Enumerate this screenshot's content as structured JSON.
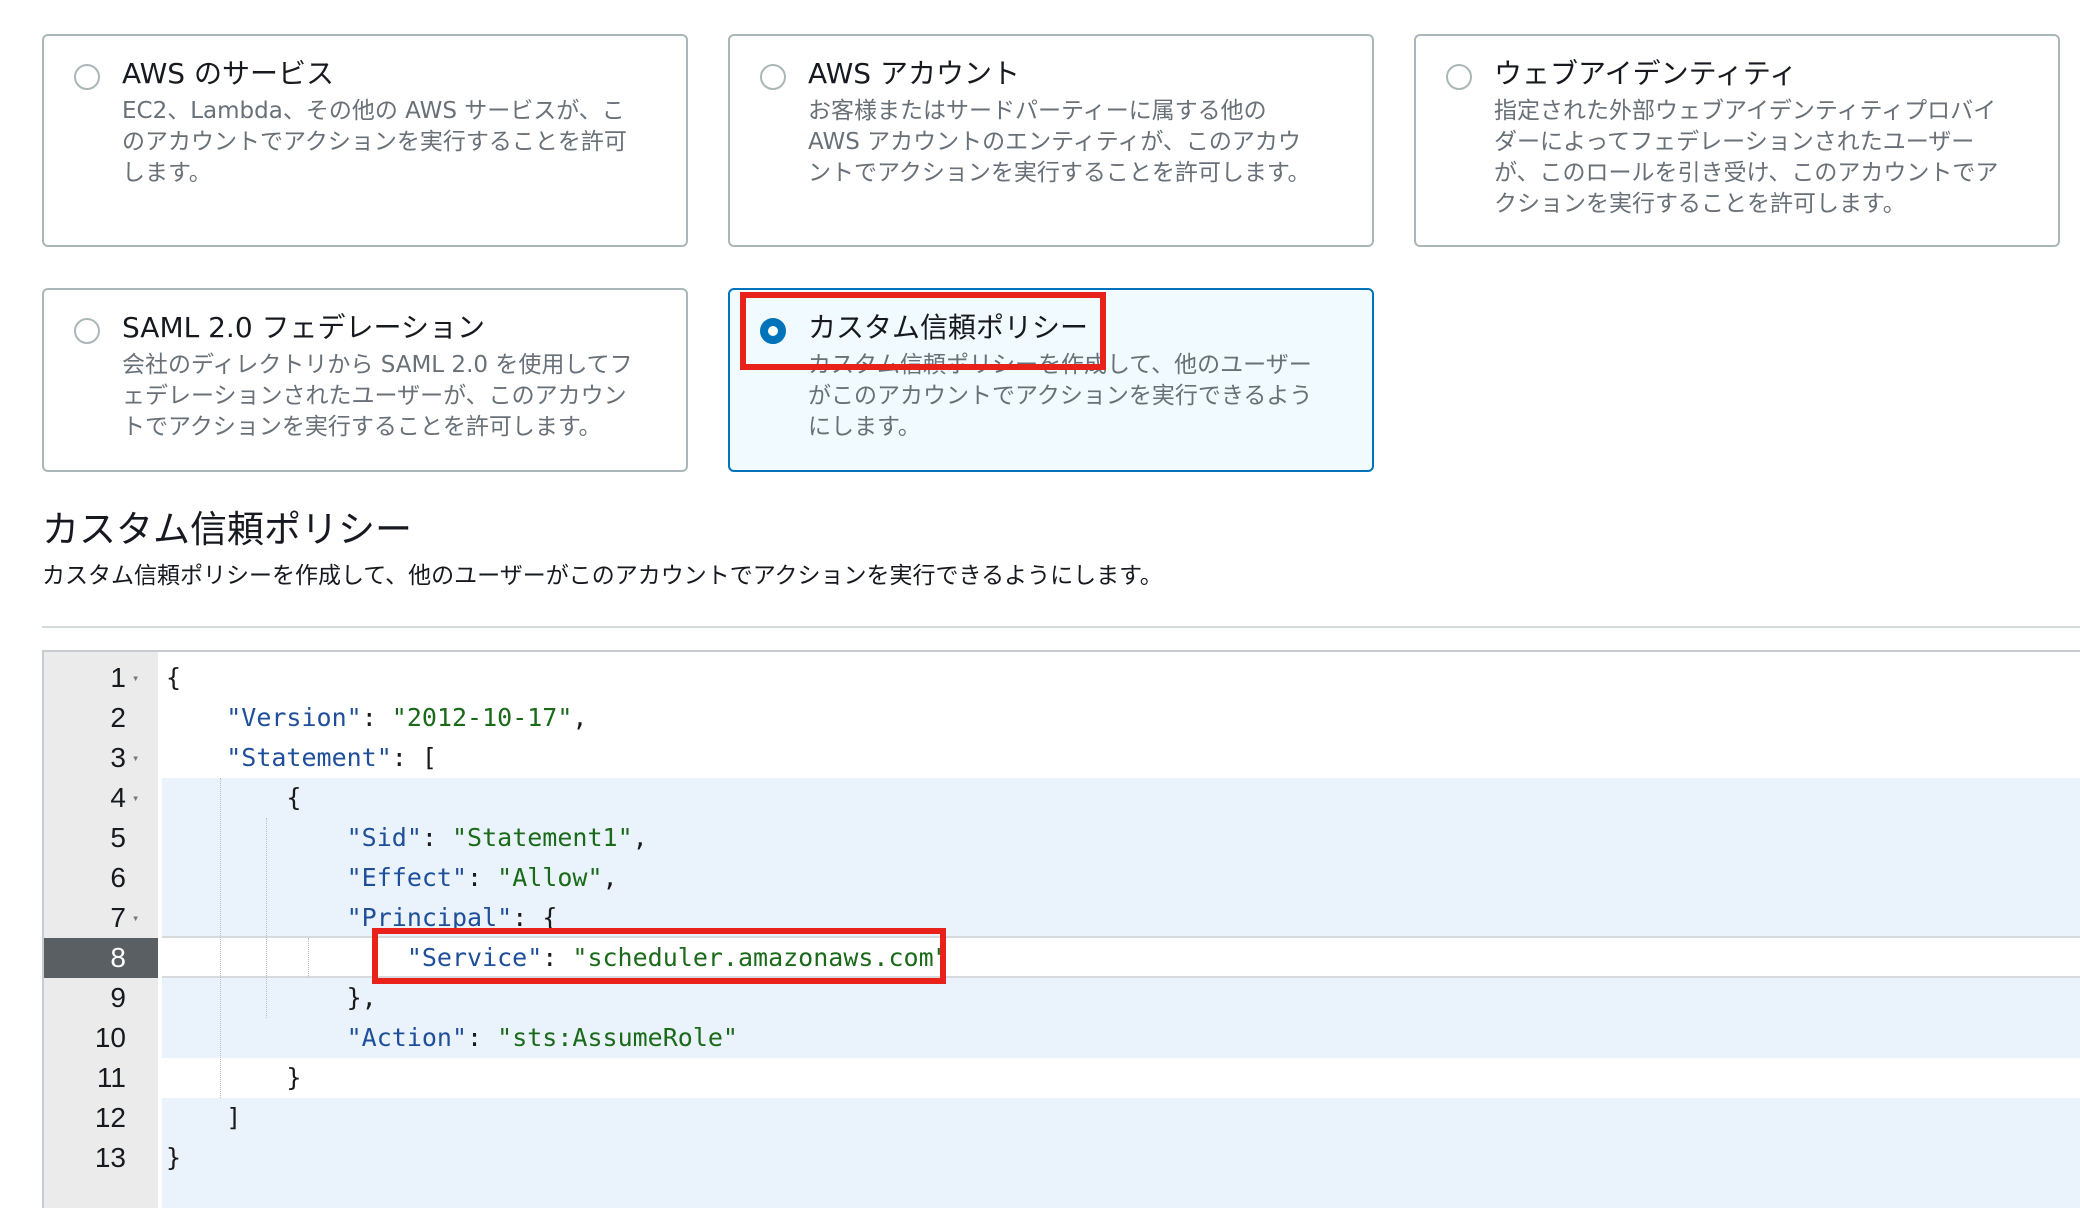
{
  "options": [
    {
      "id": "aws-service",
      "title": "AWS のサービス",
      "lines": [
        "EC2、Lambda、その他の AWS サービスが、こ",
        "のアカウントでアクションを実行することを許可",
        "します。"
      ],
      "selected": false
    },
    {
      "id": "aws-account",
      "title": "AWS アカウント",
      "lines": [
        "お客様またはサードパーティーに属する他の",
        "AWS アカウントのエンティティが、このアカウ",
        "ントでアクションを実行することを許可します。"
      ],
      "selected": false
    },
    {
      "id": "web-identity",
      "title": "ウェブアイデンティティ",
      "lines": [
        "指定された外部ウェブアイデンティティプロバイ",
        "ダーによってフェデレーションされたユーザー",
        "が、このロールを引き受け、このアカウントでア",
        "クションを実行することを許可します。"
      ],
      "selected": false
    },
    {
      "id": "saml",
      "title": "SAML 2.0 フェデレーション",
      "lines": [
        "会社のディレクトリから SAML 2.0 を使用してフ",
        "ェデレーションされたユーザーが、このアカウン",
        "トでアクションを実行することを許可します。"
      ],
      "selected": false
    },
    {
      "id": "custom-trust",
      "title": "カスタム信頼ポリシー",
      "lines": [
        "カスタム信頼ポリシーを作成して、他のユーザー",
        "がこのアカウントでアクションを実行できるよう",
        "にします。"
      ],
      "selected": true
    }
  ],
  "section": {
    "title": "カスタム信頼ポリシー",
    "description": "カスタム信頼ポリシーを作成して、他のユーザーがこのアカウントでアクションを実行できるようにします。"
  },
  "editor": {
    "active_line": 8,
    "lines": [
      {
        "n": "1",
        "fold": true
      },
      {
        "n": "2",
        "fold": false
      },
      {
        "n": "3",
        "fold": true
      },
      {
        "n": "4",
        "fold": true
      },
      {
        "n": "5",
        "fold": false
      },
      {
        "n": "6",
        "fold": false
      },
      {
        "n": "7",
        "fold": true
      },
      {
        "n": "8",
        "fold": false
      },
      {
        "n": "9",
        "fold": false
      },
      {
        "n": "10",
        "fold": false
      },
      {
        "n": "11",
        "fold": false
      },
      {
        "n": "12",
        "fold": false
      },
      {
        "n": "13",
        "fold": false
      }
    ],
    "code": {
      "l1_open": "{",
      "version_key": "\"Version\"",
      "version_val": "\"2012-10-17\"",
      "statement_key": "\"Statement\"",
      "statement_open": "[",
      "obj_open": "{",
      "sid_key": "\"Sid\"",
      "sid_val": "\"Statement1\"",
      "effect_key": "\"Effect\"",
      "effect_val": "\"Allow\"",
      "principal_key": "\"Principal\"",
      "principal_open": "{",
      "service_key": "\"Service\"",
      "service_val": "\"scheduler.amazonaws.com\"",
      "principal_close": "},",
      "action_key": "\"Action\"",
      "action_val": "\"sts:AssumeRole\"",
      "obj_close": "}",
      "statement_close": "]",
      "root_close": "}"
    }
  },
  "colors": {
    "selected_border": "#0073bb",
    "selected_bg": "#f1faff",
    "highlight_red": "#e8211b",
    "json_key": "#1f4e9a",
    "json_string": "#1a6a1a"
  }
}
